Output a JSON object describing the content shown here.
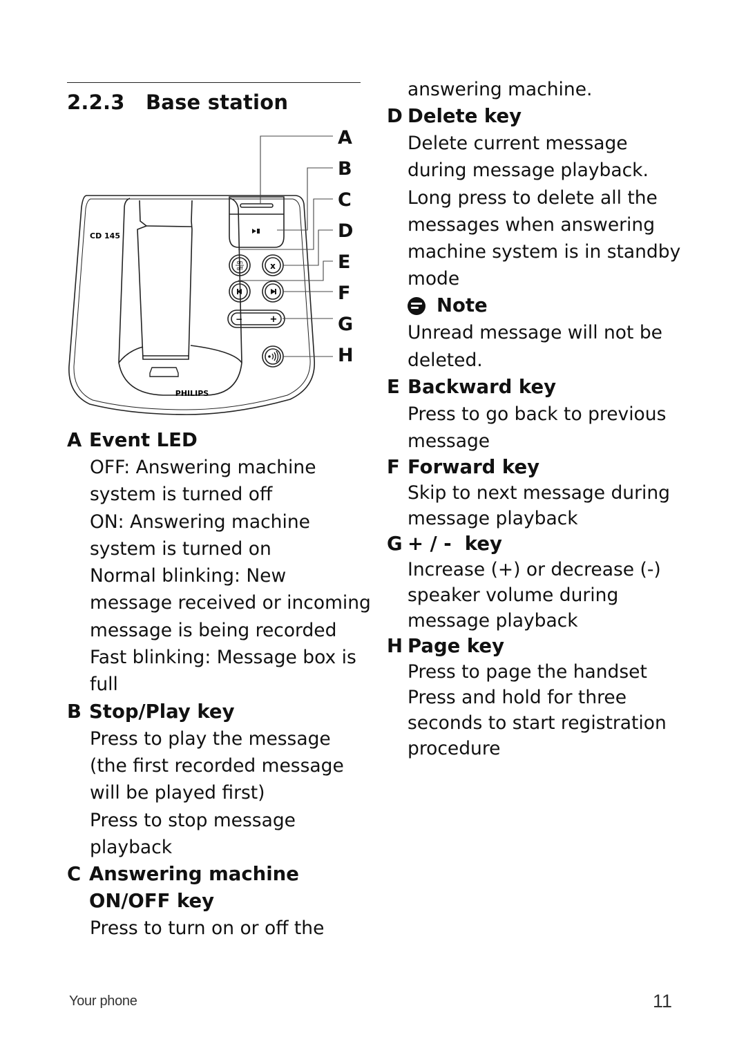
{
  "section": {
    "number": "2.2.3",
    "title": "Base station"
  },
  "diagram": {
    "model_label": "CD 145",
    "brand_label": "PHILIPS",
    "callouts": [
      "A",
      "B",
      "C",
      "D",
      "E",
      "F",
      "G",
      "H"
    ],
    "button_labels": {
      "on_off_top": "on",
      "on_off_bottom": "off",
      "delete": "x",
      "minus": "−",
      "plus": "+"
    }
  },
  "items": [
    {
      "letter": "A",
      "title": [
        "Event LED"
      ],
      "lines": [
        "OFF: Answering machine",
        "system is turned off",
        "ON: Answering machine",
        "system is turned on",
        "Normal blinking: New",
        "message received or incoming",
        "message is being recorded",
        "Fast blinking: Message box is",
        "full"
      ]
    },
    {
      "letter": "B",
      "title": [
        "Stop/Play key"
      ],
      "lines": [
        "Press to play the message",
        "(the first recorded message",
        "will be played first)",
        "Press to stop message",
        "playback"
      ]
    },
    {
      "letter": "C",
      "title": [
        "Answering machine",
        "ON/OFF key"
      ],
      "lines": [
        "Press to turn on or off the",
        "answering machine."
      ]
    },
    {
      "letter": "D",
      "title": [
        "Delete key"
      ],
      "lines": [
        "Delete current message",
        "during message playback.",
        "Long press to delete all the",
        "messages when answering",
        "machine system is in standby",
        "mode"
      ],
      "note": {
        "title": "Note",
        "lines": [
          "Unread message will not be",
          "deleted."
        ]
      }
    },
    {
      "letter": "E",
      "title": [
        "Backward key"
      ],
      "lines": [
        "Press to go back to previous",
        "message"
      ]
    },
    {
      "letter": "F",
      "title": [
        "Forward key"
      ],
      "lines": [
        "Skip to next message during",
        "message playback"
      ]
    },
    {
      "letter": "G",
      "title": [
        "+ / -  key"
      ],
      "lines": [
        "Increase (+) or decrease (-)",
        "speaker volume during",
        "message playback"
      ]
    },
    {
      "letter": "H",
      "title": [
        "Page key"
      ],
      "lines": [
        "Press to page the handset",
        "Press and hold for three",
        "seconds to start registration",
        "procedure"
      ]
    }
  ],
  "footer": {
    "section_name": "Your phone",
    "page_number": "11"
  }
}
